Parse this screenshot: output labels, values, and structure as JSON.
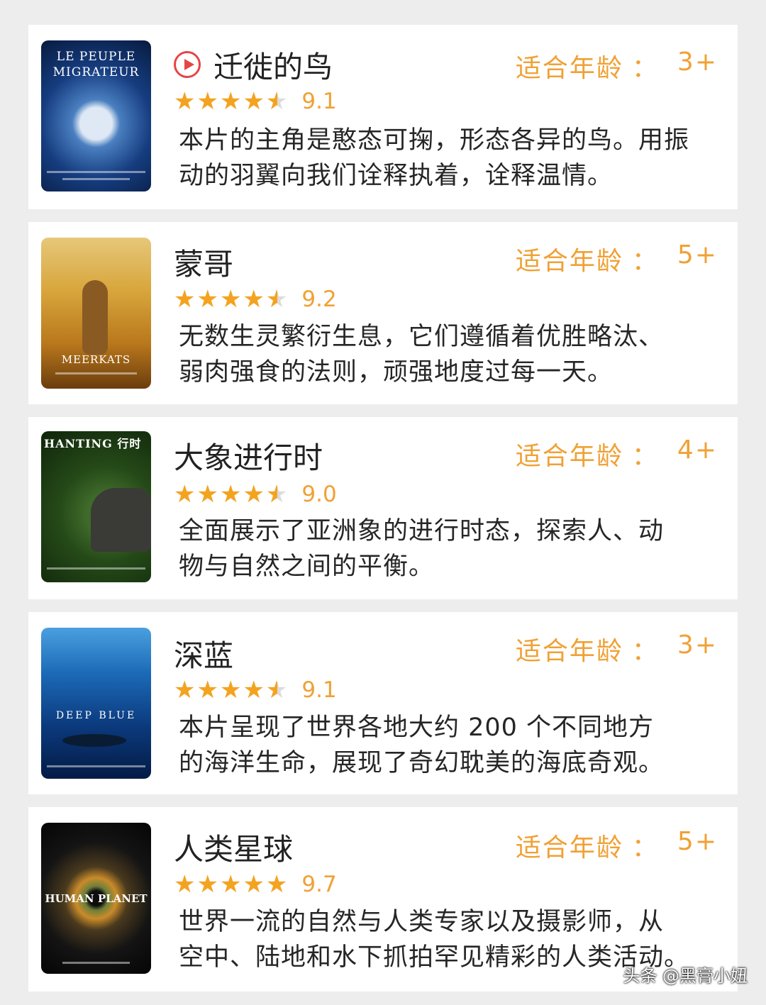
{
  "age_label": "适合年龄",
  "age_separator": "：",
  "cards": [
    {
      "title": "迁徙的鸟",
      "poster_text": "LE PEUPLE MIGRATEUR",
      "age": "3+",
      "rating": 9.1,
      "stars_filled": 4.5,
      "desc_line1": "本片的主角是憨态可掬，形态各异的鸟。用振",
      "desc_line2": "动的羽翼向我们诠释执着，诠释温情。"
    },
    {
      "title": "蒙哥",
      "poster_text": "MEERKATS",
      "age": "5+",
      "rating": 9.2,
      "stars_filled": 4.5,
      "desc_line1": "无数生灵繁衍生息，它们遵循着优胜略汰、",
      "desc_line2": "弱肉强食的法则，顽强地度过每一天。"
    },
    {
      "title": "大象进行时",
      "poster_text": "HANTING 行时",
      "age": "4+",
      "rating": 9.0,
      "stars_filled": 4.5,
      "desc_line1": "全面展示了亚洲象的进行时态，探索人、动",
      "desc_line2": "物与自然之间的平衡。"
    },
    {
      "title": "深蓝",
      "poster_text": "DEEP BLUE",
      "age": "3+",
      "rating": 9.1,
      "stars_filled": 4.5,
      "desc_line1": "本片呈现了世界各地大约 200 个不同地方",
      "desc_line2": "的海洋生命，展现了奇幻耽美的海底奇观。"
    },
    {
      "title": "人类星球",
      "poster_text": "HUMAN PLANET",
      "age": "5+",
      "rating": 9.7,
      "stars_filled": 5,
      "desc_line1": "世界一流的自然与人类专家以及摄影师，从",
      "desc_line2": "空中、陆地和水下抓拍罕见精彩的人类活动。"
    }
  ],
  "watermark": "头条 @黑膏小妞",
  "star_glyphs": "★★★★★",
  "accent_color": "#f0a135",
  "star_color": "#f4a31f",
  "play_icon_color": "#e64545"
}
